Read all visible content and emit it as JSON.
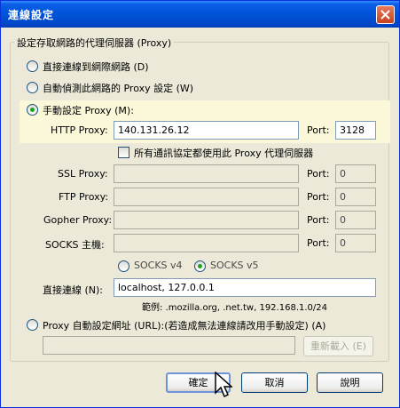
{
  "window": {
    "title": "連線設定"
  },
  "group_label": "設定存取網路的代理伺服器 (Proxy)",
  "options": {
    "direct": "直接連線到網際網路 (D)",
    "auto_detect": "自動偵測此網路的 Proxy 設定 (W)",
    "manual": "手動設定 Proxy (M):",
    "auto_url": "Proxy 自動設定網址 (URL):(若造成無法連線請改用手動設定) (A)"
  },
  "manual": {
    "http_label": "HTTP Proxy:",
    "http_value": "140.131.26.12",
    "http_port_label": "Port:",
    "http_port_value": "3128",
    "same_proxy_label": "所有通訊協定都使用此 Proxy 代理伺服器",
    "ssl_label": "SSL Proxy:",
    "ssl_port_label": "Port:",
    "ssl_port_value": "0",
    "ftp_label": "FTP Proxy:",
    "ftp_port_label": "Port:",
    "ftp_port_value": "0",
    "gopher_label": "Gopher Proxy:",
    "gopher_port_label": "Port:",
    "gopher_port_value": "0",
    "socks_label": "SOCKS 主機:",
    "socks_port_label": "Port:",
    "socks_port_value": "0",
    "socks_v4": "SOCKS v4",
    "socks_v5": "SOCKS v5",
    "no_proxy_label": "直接連線 (N):",
    "no_proxy_value": "localhost, 127.0.0.1",
    "example": "範例: .mozilla.org, .net.tw, 192.168.1.0/24"
  },
  "reload_label": "重新載入 (E)",
  "buttons": {
    "ok": "確定",
    "cancel": "取消",
    "help": "說明"
  },
  "selected_option": "manual",
  "selected_socks": "v5",
  "colors": {
    "titlebar": "#0053d8",
    "dialog_bg": "#ece9d8",
    "highlight": "#fbf7d9",
    "radio_dot": "#21a121"
  }
}
